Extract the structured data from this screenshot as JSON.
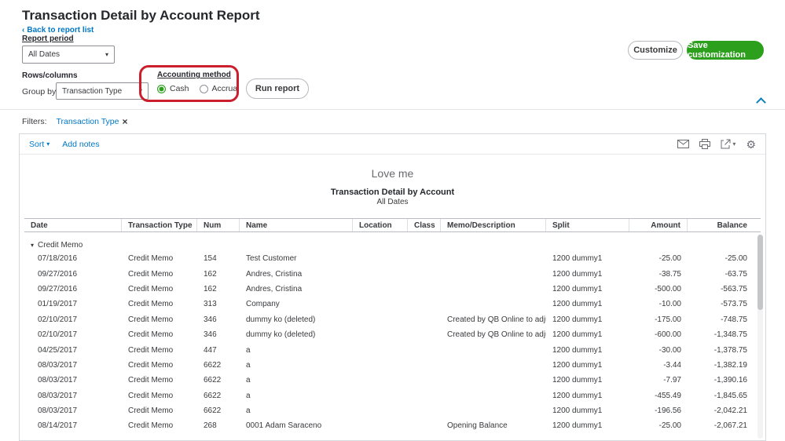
{
  "colors": {
    "brand_green": "#2ca01c",
    "link_teal": "#0077c5",
    "highlight_red": "#cb1f2e"
  },
  "icons": {
    "back_chevron": "‹",
    "caret_down": "▾",
    "close": "×",
    "gear": "⚙"
  },
  "header": {
    "title": "Transaction Detail by Account Report",
    "back_link": "Back to report list",
    "report_period_label": "Report period",
    "period_value": "All Dates",
    "customize": "Customize",
    "save_customization": "Save customization",
    "rows_columns_label": "Rows/columns",
    "group_by_label": "Group by",
    "group_by_value": "Transaction Type",
    "accounting_method": {
      "label": "Accounting method",
      "options": [
        "Cash",
        "Accrual"
      ],
      "selected": "Cash"
    },
    "run_report": "Run report"
  },
  "filters": {
    "label": "Filters:",
    "active_filter": "Transaction Type"
  },
  "toolbar": {
    "sort": "Sort",
    "add_notes": "Add notes"
  },
  "report": {
    "company": "Love me",
    "title": "Transaction Detail by Account",
    "subtitle": "All Dates"
  },
  "table": {
    "columns": [
      "Date",
      "Transaction Type",
      "Num",
      "Name",
      "Location",
      "Class",
      "Memo/Description",
      "Split",
      "Amount",
      "Balance"
    ],
    "group_label": "Credit Memo",
    "rows": [
      [
        "07/18/2016",
        "Credit Memo",
        "154",
        "Test Customer",
        "",
        "",
        "",
        "1200 dummy1",
        "-25.00",
        "-25.00"
      ],
      [
        "09/27/2016",
        "Credit Memo",
        "162",
        "Andres, Cristina",
        "",
        "",
        "",
        "1200 dummy1",
        "-38.75",
        "-63.75"
      ],
      [
        "09/27/2016",
        "Credit Memo",
        "162",
        "Andres, Cristina",
        "",
        "",
        "",
        "1200 dummy1",
        "-500.00",
        "-563.75"
      ],
      [
        "01/19/2017",
        "Credit Memo",
        "313",
        "Company",
        "",
        "",
        "",
        "1200 dummy1",
        "-10.00",
        "-573.75"
      ],
      [
        "02/10/2017",
        "Credit Memo",
        "346",
        "dummy ko (deleted)",
        "",
        "",
        "Created by QB Online to adjust ...",
        "1200 dummy1",
        "-175.00",
        "-748.75"
      ],
      [
        "02/10/2017",
        "Credit Memo",
        "346",
        "dummy ko (deleted)",
        "",
        "",
        "Created by QB Online to adjust ...",
        "1200 dummy1",
        "-600.00",
        "-1,348.75"
      ],
      [
        "04/25/2017",
        "Credit Memo",
        "447",
        "a",
        "",
        "",
        "",
        "1200 dummy1",
        "-30.00",
        "-1,378.75"
      ],
      [
        "08/03/2017",
        "Credit Memo",
        "6622",
        "a",
        "",
        "",
        "",
        "1200 dummy1",
        "-3.44",
        "-1,382.19"
      ],
      [
        "08/03/2017",
        "Credit Memo",
        "6622",
        "a",
        "",
        "",
        "",
        "1200 dummy1",
        "-7.97",
        "-1,390.16"
      ],
      [
        "08/03/2017",
        "Credit Memo",
        "6622",
        "a",
        "",
        "",
        "",
        "1200 dummy1",
        "-455.49",
        "-1,845.65"
      ],
      [
        "08/03/2017",
        "Credit Memo",
        "6622",
        "a",
        "",
        "",
        "",
        "1200 dummy1",
        "-196.56",
        "-2,042.21"
      ],
      [
        "08/14/2017",
        "Credit Memo",
        "268",
        "0001 Adam Saraceno",
        "",
        "",
        "Opening Balance",
        "1200 dummy1",
        "-25.00",
        "-2,067.21"
      ]
    ]
  }
}
